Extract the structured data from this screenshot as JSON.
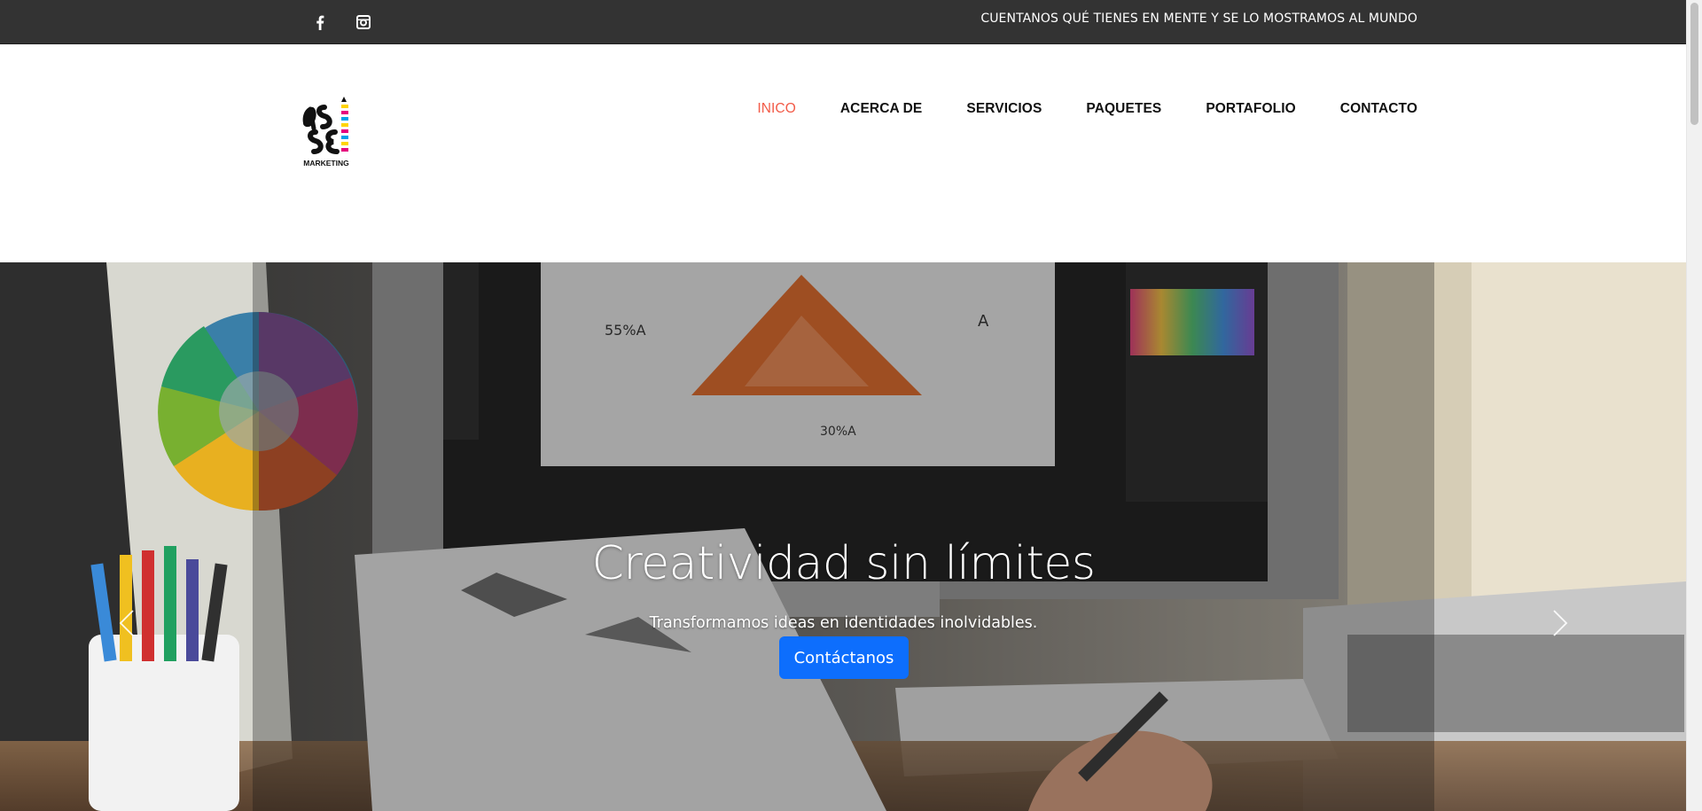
{
  "topbar": {
    "social": [
      {
        "name": "facebook-icon",
        "label": "f"
      },
      {
        "name": "instagram-icon",
        "label": ""
      }
    ],
    "tagline": "CUENTANOS QUÉ TIENES EN MENTE Y SE LO MOSTRAMOS AL MUNDO",
    "bg_color": "#333333"
  },
  "header": {
    "logo_text": "MARKETING",
    "logo_letters": "AS SE",
    "nav": [
      {
        "label": "INICO",
        "active": true
      },
      {
        "label": "ACERCA DE",
        "active": false
      },
      {
        "label": "SERVICIOS",
        "active": false
      },
      {
        "label": "PAQUETES",
        "active": false
      },
      {
        "label": "PORTAFOLIO",
        "active": false
      },
      {
        "label": "CONTACTO",
        "active": false
      }
    ],
    "active_color": "#f25a47"
  },
  "hero": {
    "title": "Creatividad sin límites",
    "subtitle": "Transformamos ideas en identidades inolvidables.",
    "button_label": "Contáctanos",
    "button_color": "#0d6efd",
    "prev_icon": "chevron-left-icon",
    "next_icon": "chevron-right-icon",
    "scene_labels": {
      "percent_a": "55%A",
      "percent_b": "30%A",
      "letter_a": "A"
    }
  }
}
